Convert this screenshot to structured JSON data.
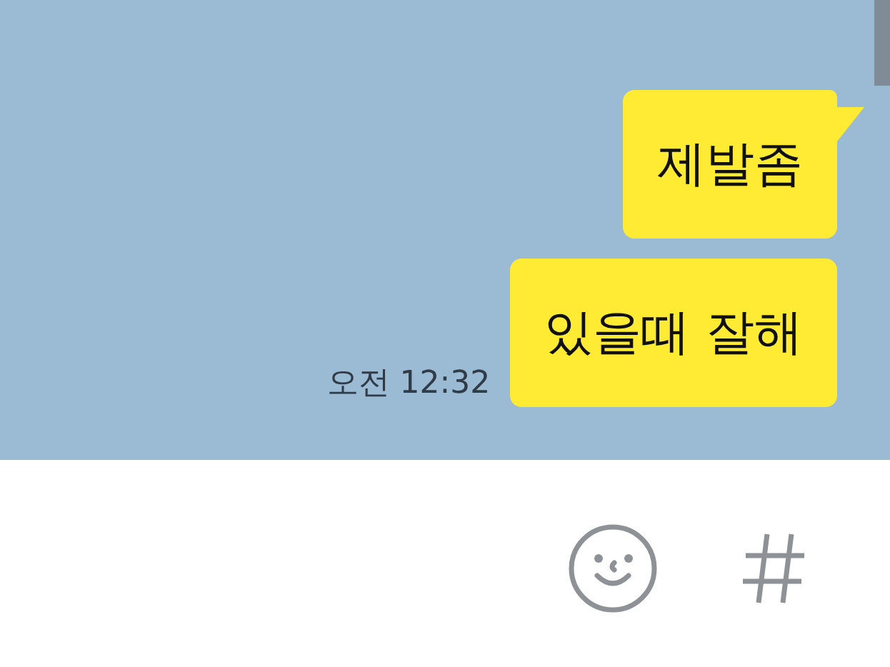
{
  "messages": [
    {
      "text": "제발좀",
      "tail": true
    },
    {
      "text": "있을때 잘해",
      "tail": false,
      "time": "오전 12:32"
    }
  ]
}
